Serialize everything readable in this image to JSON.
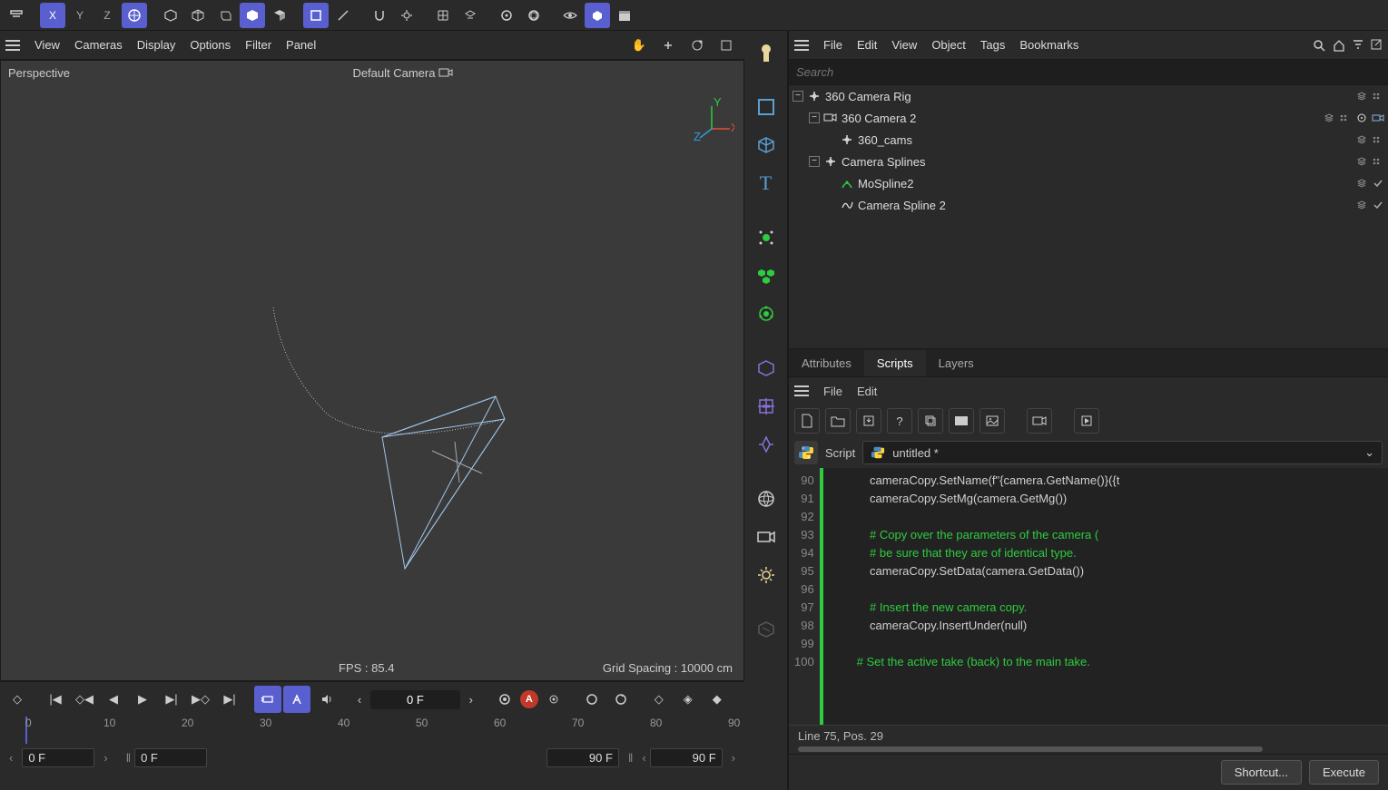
{
  "topToolbar": {
    "groups": [
      "undo",
      "x",
      "y",
      "z",
      "world",
      "cube1",
      "cube2",
      "cube3",
      "cube4",
      "cube5",
      "rect",
      "line",
      "magnet",
      "gear",
      "grid",
      "grid2",
      "dot",
      "boolean",
      "eye",
      "iso",
      "clapper"
    ]
  },
  "viewMenu": {
    "items": [
      "View",
      "Cameras",
      "Display",
      "Options",
      "Filter",
      "Panel"
    ]
  },
  "viewport": {
    "labelLeft": "Perspective",
    "labelCenter": "Default Camera",
    "fps": "FPS : 85.4",
    "gridSpacing": "Grid Spacing : 10000 cm",
    "axes": {
      "x": "X",
      "y": "Y",
      "z": "Z"
    }
  },
  "timeline": {
    "currentFrame": "0 F",
    "ticks": [
      "0",
      "10",
      "20",
      "30",
      "40",
      "50",
      "60",
      "70",
      "80",
      "90"
    ],
    "startFrame": "0 F",
    "endFrame": "90 F",
    "rangeEnd": "90 F"
  },
  "objectManager": {
    "menu": [
      "File",
      "Edit",
      "View",
      "Object",
      "Tags",
      "Bookmarks"
    ],
    "searchPlaceholder": "Search",
    "tree": [
      {
        "depth": 0,
        "expand": "-",
        "icon": "null",
        "name": "360 Camera Rig",
        "tags": [
          "layer",
          "dots"
        ]
      },
      {
        "depth": 1,
        "expand": "-",
        "icon": "camera",
        "name": "360 Camera 2",
        "tags": [
          "layer",
          "dots",
          "target",
          "cam"
        ]
      },
      {
        "depth": 2,
        "expand": "",
        "icon": "null",
        "name": "360_cams",
        "tags": [
          "layer",
          "dots"
        ]
      },
      {
        "depth": 1,
        "expand": "-",
        "icon": "null",
        "name": "Camera Splines",
        "tags": [
          "layer",
          "dots"
        ]
      },
      {
        "depth": 2,
        "expand": "",
        "icon": "mospline",
        "name": "MoSpline2",
        "tags": [
          "layer",
          "check"
        ]
      },
      {
        "depth": 2,
        "expand": "",
        "icon": "spline",
        "name": "Camera Spline 2",
        "tags": [
          "layer",
          "check"
        ]
      }
    ]
  },
  "tabs": {
    "items": [
      "Attributes",
      "Scripts",
      "Layers"
    ],
    "active": 1
  },
  "scriptMenu": [
    "File",
    "Edit"
  ],
  "scriptHeader": {
    "label": "Script",
    "name": "untitled *"
  },
  "code": {
    "startLine": 90,
    "lines": [
      {
        "n": 90,
        "t": "            cameraCopy.SetName(f\"{camera.GetName()}({t"
      },
      {
        "n": 91,
        "t": "            cameraCopy.SetMg(camera.GetMg())"
      },
      {
        "n": 92,
        "t": ""
      },
      {
        "n": 93,
        "t": "            # Copy over the parameters of the camera (",
        "c": true
      },
      {
        "n": 94,
        "t": "            # be sure that they are of identical type.",
        "c": true
      },
      {
        "n": 95,
        "t": "            cameraCopy.SetData(camera.GetData())"
      },
      {
        "n": 96,
        "t": ""
      },
      {
        "n": 97,
        "t": "            # Insert the new camera copy.",
        "c": true
      },
      {
        "n": 98,
        "t": "            cameraCopy.InsertUnder(null)"
      },
      {
        "n": 99,
        "t": ""
      },
      {
        "n": 100,
        "t": "        # Set the active take (back) to the main take.",
        "c": true
      }
    ]
  },
  "statusBar": "Line 75, Pos. 29",
  "buttons": {
    "shortcut": "Shortcut...",
    "execute": "Execute"
  }
}
